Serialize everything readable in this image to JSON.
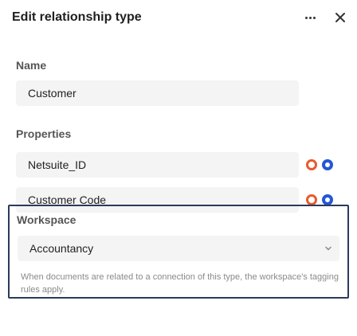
{
  "header": {
    "title": "Edit relationship type",
    "more_icon": "more-horizontal-icon",
    "close_icon": "close-icon"
  },
  "name_section": {
    "label": "Name",
    "value": "Customer"
  },
  "properties_section": {
    "label": "Properties",
    "items": [
      {
        "name": "Netsuite_ID"
      },
      {
        "name": "Customer Code"
      }
    ],
    "action_icons": [
      "remove-circle-icon",
      "radio-selected-icon"
    ]
  },
  "workspace_section": {
    "label": "Workspace",
    "selected": "Accountancy",
    "dropdown_icon": "chevron-down-icon",
    "help_text": "When documents are related to a connection of this type, the workspace's tagging rules apply."
  },
  "colors": {
    "accent_orange": "#e85a2a",
    "accent_blue": "#2456d6",
    "focus_border": "#2b3a5c"
  }
}
